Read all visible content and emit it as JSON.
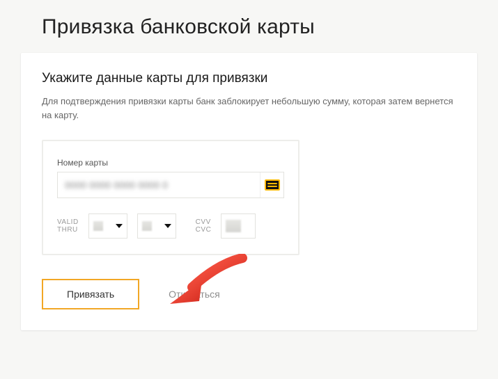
{
  "page": {
    "title": "Привязка банковской карты"
  },
  "section": {
    "title": "Укажите данные карты для привязки",
    "description": "Для подтверждения привязки карты банк заблокирует небольшую сумму, которая затем вернется на карту."
  },
  "form": {
    "card_number_label": "Номер карты",
    "valid_thru_label_line1": "VALID",
    "valid_thru_label_line2": "THRU",
    "cvv_label_line1": "CVV",
    "cvv_label_line2": "CVC"
  },
  "actions": {
    "primary": "Привязать",
    "secondary": "Отказаться"
  }
}
